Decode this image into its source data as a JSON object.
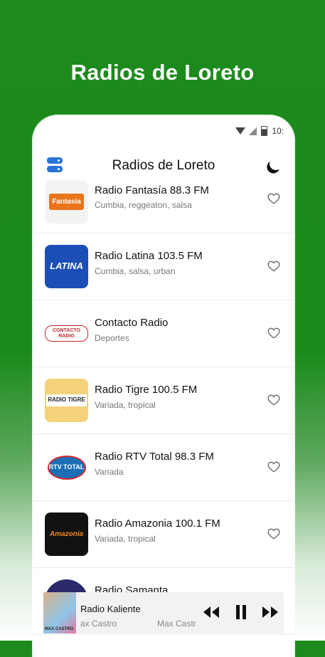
{
  "promo": {
    "title": "Radios de Loreto"
  },
  "status": {
    "time": "10:"
  },
  "appbar": {
    "title": "Radios de Loreto"
  },
  "stations": [
    {
      "name": "Radio Fantasía 88.3 FM",
      "genre": "Cumbia, reggeaton, salsa",
      "logo": "Fantasía",
      "logo_bg": "#f3f3f3",
      "logo_color": "#e8741c"
    },
    {
      "name": "Radio Latina 103.5 FM",
      "genre": "Cumbia, salsa, urban",
      "logo": "LATINA",
      "logo_bg": "#1b4fb5",
      "logo_color": "#ffffff"
    },
    {
      "name": "Contacto Radio",
      "genre": "Deportes",
      "logo": "CONTACTO RADIO",
      "logo_bg": "#ffffff",
      "logo_color": "#c0282e"
    },
    {
      "name": "Radio Tigre 100.5 FM",
      "genre": "Variada, tropical",
      "logo": "RADIO TIGRE",
      "logo_bg": "#f4d27a",
      "logo_color": "#222222"
    },
    {
      "name": "Radio RTV Total 98.3 FM",
      "genre": "Variada",
      "logo": "RTV TOTAL",
      "logo_bg": "#ffffff",
      "logo_color": "#1a6fb5"
    },
    {
      "name": "Radio Amazonia 100.1 FM",
      "genre": "Variada, tropical",
      "logo": "Amazonia",
      "logo_bg": "#111111",
      "logo_color": "#f08a1c"
    },
    {
      "name": "Radio Samanta",
      "genre": "",
      "logo": "",
      "logo_bg": "#2a2a6a",
      "logo_color": "#ffffff"
    }
  ],
  "player": {
    "title": "Radio Kaliente",
    "subtitle": "ax Castro",
    "subtitle2": "Max Castr",
    "art_label": "MAX CASTRO"
  }
}
